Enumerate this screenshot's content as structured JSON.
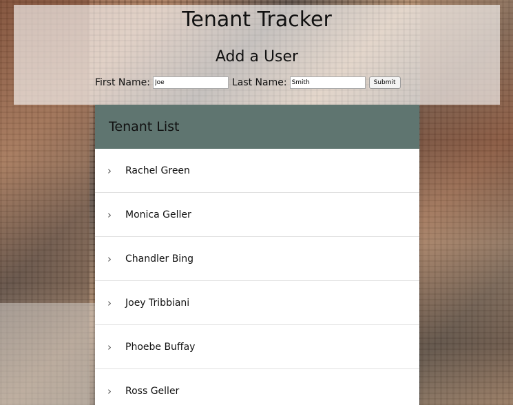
{
  "app": {
    "title": "Tenant Tracker"
  },
  "add_user": {
    "heading": "Add a User",
    "first_name_label": "First Name:",
    "first_name_value": "Joe",
    "last_name_label": "Last Name:",
    "last_name_value": "Smith",
    "submit_label": "Submit"
  },
  "tenant_list": {
    "heading": "Tenant List",
    "items": [
      {
        "name": "Rachel Green"
      },
      {
        "name": "Monica Geller"
      },
      {
        "name": "Chandler Bing"
      },
      {
        "name": "Joey Tribbiani"
      },
      {
        "name": "Phoebe Buffay"
      },
      {
        "name": "Ross Geller"
      }
    ],
    "expand_icon": "chevron-right-icon"
  },
  "colors": {
    "list_header_bg": "#5f7570",
    "header_overlay": "rgba(255,255,255,0.62)"
  }
}
